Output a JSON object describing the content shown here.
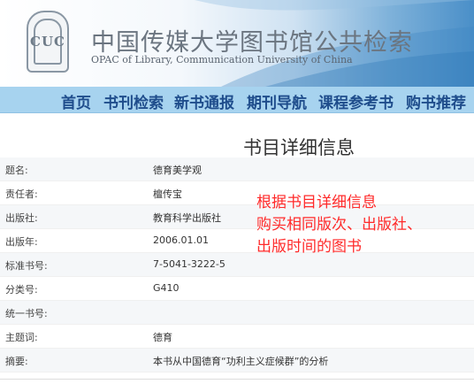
{
  "header": {
    "title_cn": "中国传媒大学图书馆公共检索",
    "title_en": "OPAC of Library, Communication University of China",
    "logo_text": "CUC"
  },
  "nav": {
    "items": [
      {
        "label": "首页"
      },
      {
        "label": "书刊检索"
      },
      {
        "label": "新书通报"
      },
      {
        "label": "期刊导航"
      },
      {
        "label": "课程参考书"
      },
      {
        "label": "购书推荐"
      }
    ]
  },
  "page_title": "书目详细信息",
  "details": [
    {
      "key": "题名:",
      "value": "德育美学观"
    },
    {
      "key": "责任者:",
      "value": "檀传宝"
    },
    {
      "key": "出版社:",
      "value": "教育科学出版社"
    },
    {
      "key": "出版年:",
      "value": "2006.01.01"
    },
    {
      "key": "标准书号:",
      "value": "7-5041-3222-5"
    },
    {
      "key": "分类号:",
      "value": "G410"
    },
    {
      "key": "统一书号:",
      "value": ""
    },
    {
      "key": "主题词:",
      "value": "德育"
    },
    {
      "key": "摘要:",
      "value": "本书从中国德育“功利主义症候群”的分析"
    }
  ],
  "annotation": {
    "line1": "根据书目详细信息",
    "line2": "购买相同版次、出版社、",
    "line3": "出版时间的图书",
    "color": "#ff2a2a"
  },
  "colors": {
    "nav_bg": "#a7d3ef",
    "nav_text": "#1f4d8c"
  }
}
